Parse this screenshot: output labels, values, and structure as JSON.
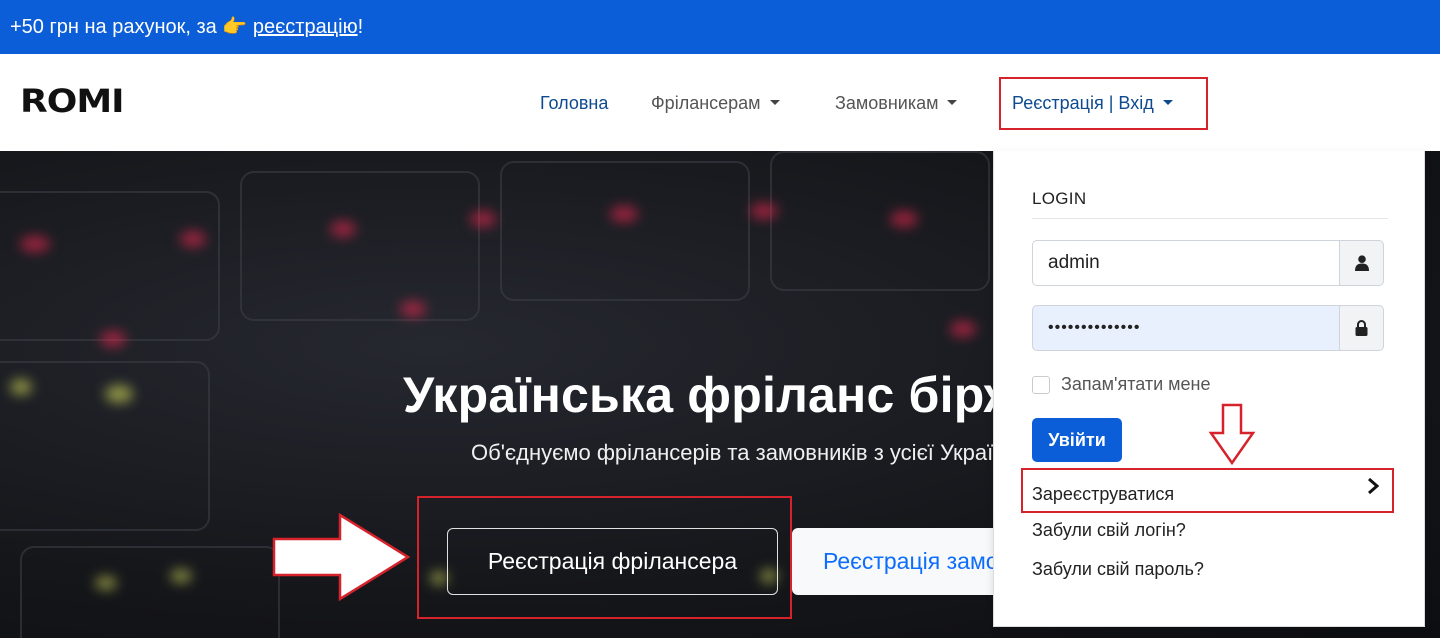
{
  "promo": {
    "text": "+50 грн на рахунок, за ",
    "emoji": "👉",
    "link": "реєстрацію",
    "suffix": "!"
  },
  "navbar": {
    "logo": "ROMI",
    "items": [
      {
        "label": "Головна"
      },
      {
        "label": "Фрілансерам"
      },
      {
        "label": "Замовникам"
      },
      {
        "label": "Реєстрація | Вхід"
      }
    ]
  },
  "hero": {
    "title": "Українська фріланс біржа",
    "subtitle": "Об'єднуємо фрілансерів та замовників з усієї України",
    "btn_freelancer": "Реєстрація фрілансера",
    "btn_client": "Реєстрація замовника"
  },
  "login": {
    "title": "LOGIN",
    "username": "admin",
    "password": "••••••••••••••",
    "remember": "Запам'ятати мене",
    "submit": "Увійти",
    "register": "Зареєструватися",
    "forgot_login": "Забули свій логін?",
    "forgot_password": "Забули свій пароль?"
  },
  "colors": {
    "primary": "#0b5ed7",
    "annotation": "#d6222a",
    "nav_active": "#0d4a8f"
  }
}
